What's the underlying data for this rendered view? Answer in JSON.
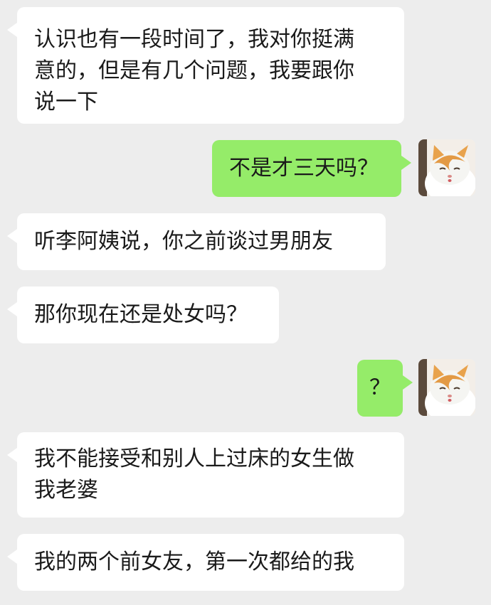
{
  "conversation": {
    "messages": [
      {
        "side": "left",
        "text": "认识也有一段时间了，我对你挺满\n意的，但是有几个问题，我要跟你\n说一下"
      },
      {
        "side": "right",
        "text": "不是才三天吗？"
      },
      {
        "side": "left",
        "text": "听李阿姨说，你之前谈过男朋友"
      },
      {
        "side": "left",
        "text": "那你现在还是处女吗？"
      },
      {
        "side": "right",
        "text": "？"
      },
      {
        "side": "left",
        "text": "我不能接受和别人上过床的女生做\n我老婆"
      },
      {
        "side": "left",
        "text": "我的两个前女友，第一次都给的我"
      }
    ],
    "avatar_icon": "cat-avatar-icon"
  },
  "colors": {
    "background": "#ededed",
    "incoming_bubble": "#ffffff",
    "outgoing_bubble": "#95ec69"
  }
}
